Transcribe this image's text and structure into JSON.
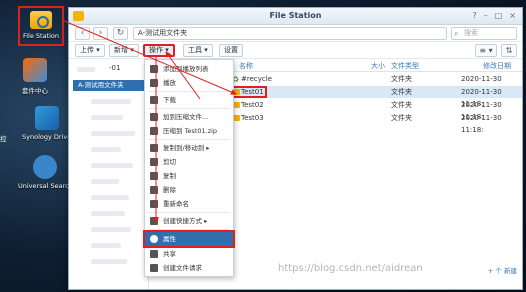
{
  "desktop": {
    "icons": [
      {
        "label": "File Station"
      },
      {
        "label": "套件中心"
      },
      {
        "label": "Synology Drive"
      },
      {
        "label": "Universal Search"
      },
      {
        "label": "控"
      }
    ]
  },
  "window": {
    "title": "File Station",
    "path": "A-测试用文件夹",
    "search_placeholder": "搜索"
  },
  "toolbar": {
    "upload": "上传",
    "new": "新增",
    "action": "操作",
    "tools": "工具",
    "settings": "设置"
  },
  "sidebar": {
    "node": "-01",
    "selected": "A-测试用文件夹"
  },
  "columns": {
    "name": "名称",
    "size": "大小",
    "type": "文件类型",
    "date": "修改日期"
  },
  "files": [
    {
      "name": "#recycle",
      "type": "文件夹",
      "date": "2020-11-30 11:10:"
    },
    {
      "name": "Test01",
      "type": "文件夹",
      "date": "2020-11-30 11:18:"
    },
    {
      "name": "Test02",
      "type": "文件夹",
      "date": "2020-11-30 11:18:"
    },
    {
      "name": "Test03",
      "type": "文件夹",
      "date": "2020-11-30 11:18:"
    }
  ],
  "menu": {
    "items": [
      "添加到播放列表",
      "播放",
      "下载",
      "加到压缩文件...",
      "压缩到 Test01.zip",
      "复制到/移动到",
      "剪切",
      "复制",
      "删除",
      "重新命名",
      "创建快捷方式",
      "属性",
      "共享",
      "创建文件请求"
    ]
  },
  "footer": {
    "add_label": "+ 个 新建"
  },
  "watermark": "https://blog.csdn.net/aidrean"
}
